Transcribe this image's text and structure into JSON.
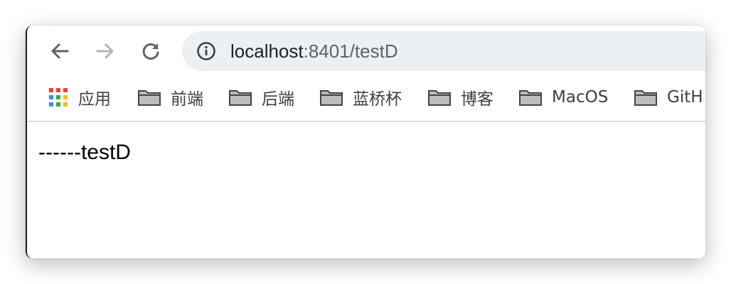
{
  "browser": {
    "url_host": "localhost",
    "url_rest": ":8401/testD"
  },
  "bookmarks": {
    "items": [
      {
        "label": "应用",
        "icon": "apps-grid-icon"
      },
      {
        "label": "前端",
        "icon": "folder-icon"
      },
      {
        "label": "后端",
        "icon": "folder-icon"
      },
      {
        "label": "蓝桥杯",
        "icon": "folder-icon"
      },
      {
        "label": "博客",
        "icon": "folder-icon"
      },
      {
        "label": "MacOS",
        "icon": "folder-icon"
      },
      {
        "label": "GitH",
        "icon": "folder-icon"
      }
    ]
  },
  "page": {
    "text": "------testD"
  },
  "colors": {
    "omnibox_bg": "#edf0f2",
    "apps_red": "#ea4335",
    "apps_blue": "#4285f4",
    "apps_green": "#34a853",
    "apps_yellow": "#fbbc05"
  }
}
